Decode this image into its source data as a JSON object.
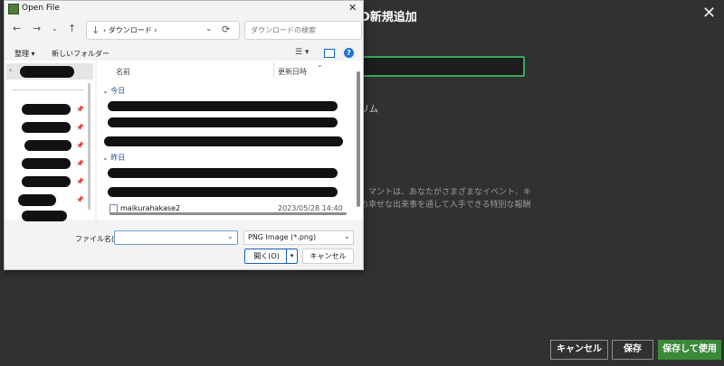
{
  "background": {
    "title": "D新規追加",
    "label_partial": "リム",
    "description_line1": "、マントは、あなたがさまざまなイベント、キ",
    "description_line2": "の幸せな出来事を通して入手できる特別な報酬",
    "buttons": {
      "cancel": "キャンセル",
      "save": "保存",
      "save_and_use": "保存して使用"
    },
    "accent_color": "#3aa757"
  },
  "dialog": {
    "title": "Open File",
    "address": "ダウンロード",
    "search_placeholder": "ダウンロードの検索",
    "toolbar": {
      "organize": "整理",
      "new_folder": "新しいフォルダー"
    },
    "columns": {
      "name": "名前",
      "date": "更新日時"
    },
    "groups": {
      "today": "今日",
      "yesterday": "昨日"
    },
    "files": [
      {
        "name": "maikurahakase2",
        "date": "2023/05/28 14:40"
      }
    ],
    "filename_label": "ファイル名(N):",
    "filename_value": "",
    "filetype": "PNG Image (*.png)",
    "open_button": "開く(O)",
    "cancel_button": "キャンセル"
  }
}
